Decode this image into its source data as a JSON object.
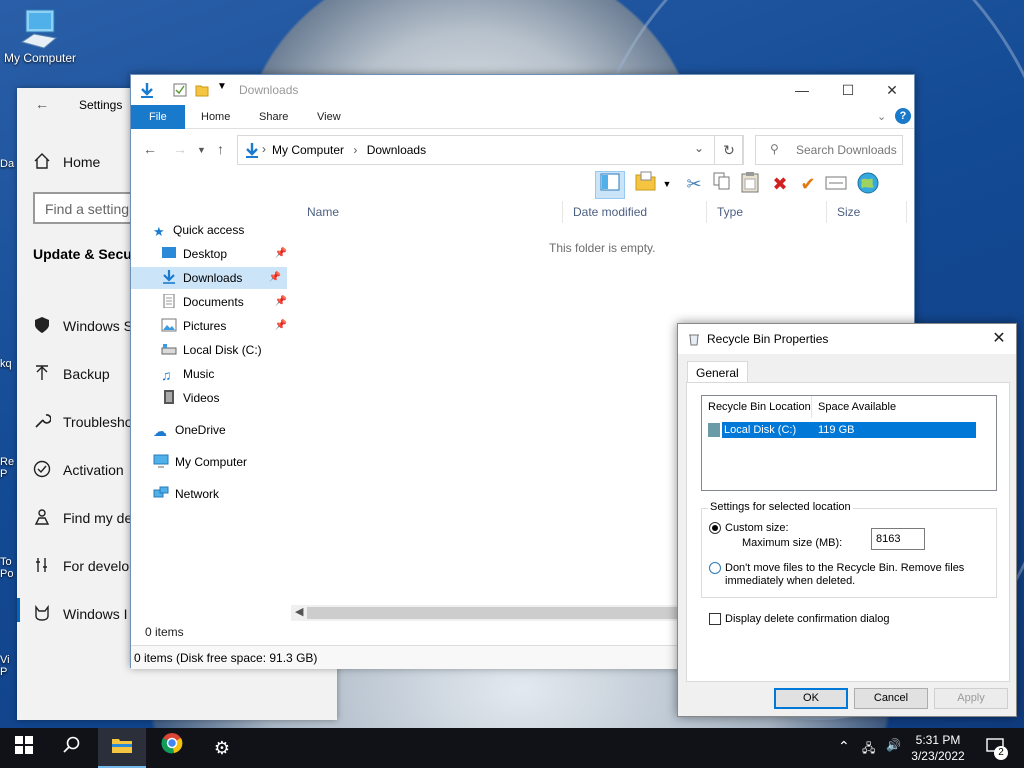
{
  "desktop": {
    "icon_label": "My Computer",
    "frags": [
      "Da",
      "kq",
      "Re P",
      "To Po",
      "Vi P"
    ]
  },
  "settings": {
    "title": "Settings",
    "home": "Home",
    "find_placeholder": "Find a setting",
    "section": "Update & Secur",
    "items": [
      "Windows S",
      "Backup",
      "Troublesho",
      "Activation",
      "Find my de",
      "For develo",
      "Windows I"
    ]
  },
  "explorer": {
    "title": "Downloads",
    "tabs": {
      "file": "File",
      "home": "Home",
      "share": "Share",
      "view": "View"
    },
    "breadcrumb": [
      "My Computer",
      "Downloads"
    ],
    "search_placeholder": "Search Downloads",
    "nav": {
      "quick_access": "Quick access",
      "desktop": "Desktop",
      "downloads": "Downloads",
      "documents": "Documents",
      "pictures": "Pictures",
      "local_disk": "Local Disk (C:)",
      "music": "Music",
      "videos": "Videos",
      "onedrive": "OneDrive",
      "my_computer": "My Computer",
      "network": "Network"
    },
    "columns": {
      "name": "Name",
      "date": "Date modified",
      "type": "Type",
      "size": "Size"
    },
    "empty_text": "This folder is empty.",
    "item_count": "0 items",
    "status": "0 items (Disk free space: 91.3 GB)"
  },
  "recycle": {
    "title": "Recycle Bin Properties",
    "tab": "General",
    "col_location": "Recycle Bin Location",
    "col_space": "Space Available",
    "row_location": "Local Disk (C:)",
    "row_space": "119 GB",
    "group_label": "Settings for selected location",
    "custom_size": "Custom size:",
    "max_size_label": "Maximum size (MB):",
    "max_size_value": "8163",
    "dont_move_1": "Don't move files to the Recycle Bin. Remove files",
    "dont_move_2": "immediately when deleted.",
    "confirm": "Display delete confirmation dialog",
    "ok": "OK",
    "cancel": "Cancel",
    "apply": "Apply"
  },
  "taskbar": {
    "time": "5:31 PM",
    "date": "3/23/2022",
    "notifications": "2"
  },
  "colors": {
    "accent": "#0078d7",
    "file_tab": "#1979ca",
    "taskbar": "#101218"
  }
}
